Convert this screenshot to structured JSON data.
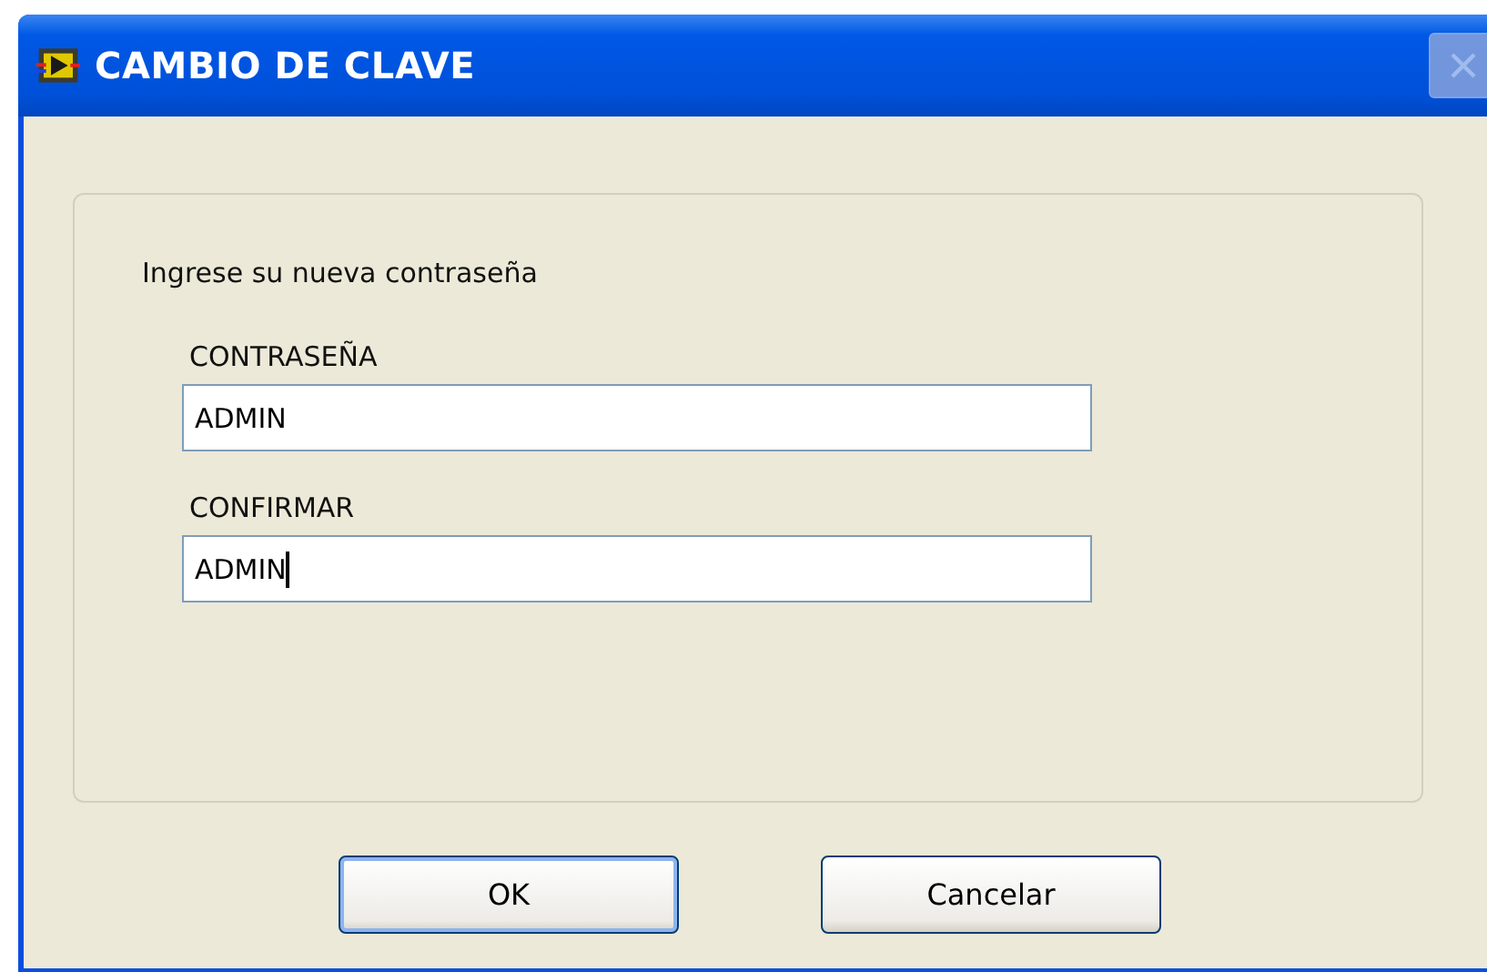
{
  "window": {
    "title": "CAMBIO DE CLAVE",
    "close_disabled": true
  },
  "prompt": "Ingrese su nueva contraseña",
  "fields": [
    {
      "label": "CONTRASEÑA",
      "value": "ADMIN",
      "focused": false
    },
    {
      "label": "CONFIRMAR",
      "value": "ADMIN",
      "focused": true
    }
  ],
  "buttons": [
    {
      "label": "OK",
      "default": true
    },
    {
      "label": "Cancelar",
      "default": false
    }
  ]
}
